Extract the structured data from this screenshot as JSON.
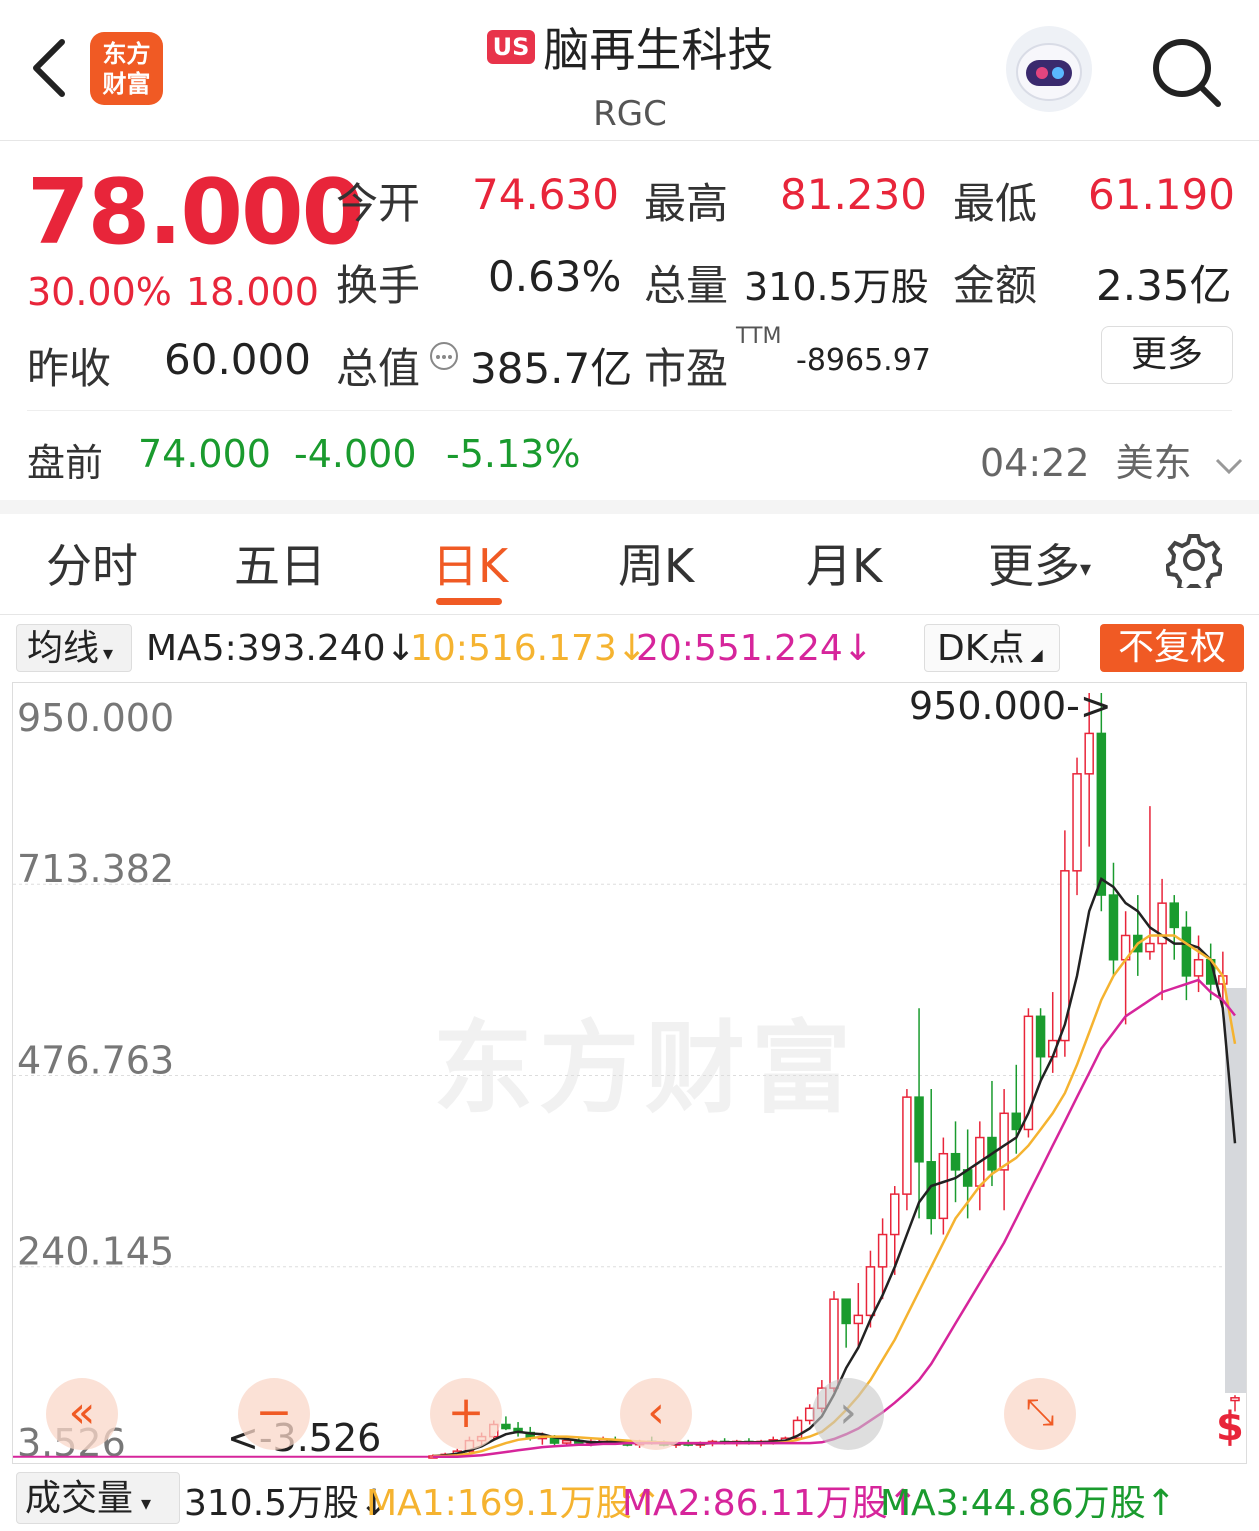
{
  "header": {
    "app_logo_line1": "东方",
    "app_logo_line2": "财富",
    "market_badge": "US",
    "stock_name": "脑再生科技",
    "ticker": "RGC"
  },
  "quote": {
    "price": "78.000",
    "change_pct": "30.00%",
    "change_abs": "18.000",
    "prev_close_label": "昨收",
    "prev_close": "60.000",
    "open_label": "今开",
    "open": "74.630",
    "high_label": "最高",
    "high": "81.230",
    "low_label": "最低",
    "low": "61.190",
    "turnover_label": "换手",
    "turnover": "0.63%",
    "volume_label": "总量",
    "volume": "310.5万股",
    "amount_label": "金额",
    "amount": "2.35亿",
    "mcap_label": "总值",
    "mcap": "385.7亿",
    "pe_label": "市盈",
    "pe_sup": "TTM",
    "pe": "-8965.97",
    "more": "更多"
  },
  "premarket": {
    "label": "盘前",
    "price": "74.000",
    "change": "-4.000",
    "pct": "-5.13%",
    "time": "04:22",
    "zone": "美东"
  },
  "tabs": [
    "分时",
    "五日",
    "日K",
    "周K",
    "月K",
    "更多"
  ],
  "active_tab": "日K",
  "ma_bar": {
    "selector": "均线",
    "ma5": "MA5:393.240↓",
    "ma10": "10:516.173↓",
    "ma20": "20:551.224↓",
    "dk": "DK点",
    "adjust": "不复权"
  },
  "volume_bar": {
    "selector": "成交量",
    "vol": "310.5万股↓",
    "ma1": "MA1:169.1万股↑",
    "ma2": "MA2:86.11万股↑",
    "ma3": "MA3:44.86万股↑"
  },
  "colors": {
    "up": "#e8253a",
    "down": "#1a9b2e",
    "accent": "#f05a24",
    "ma5": "#222222",
    "ma10": "#f5b330",
    "ma20": "#d6259b"
  },
  "chart_data": {
    "type": "candlestick",
    "y_ticks": [
      "950.000",
      "713.382",
      "476.763",
      "240.145",
      "3.526"
    ],
    "ylim": [
      3.526,
      950.0
    ],
    "max_marker": "950.000->",
    "min_marker": "<-3.526",
    "watermark": "东方财富",
    "candles": [
      {
        "o": 5,
        "h": 8,
        "l": 4,
        "c": 6
      },
      {
        "o": 6,
        "h": 10,
        "l": 5,
        "c": 8
      },
      {
        "o": 8,
        "h": 15,
        "l": 7,
        "c": 12
      },
      {
        "o": 12,
        "h": 30,
        "l": 10,
        "c": 25
      },
      {
        "o": 25,
        "h": 35,
        "l": 18,
        "c": 30
      },
      {
        "o": 30,
        "h": 50,
        "l": 25,
        "c": 45
      },
      {
        "o": 45,
        "h": 55,
        "l": 38,
        "c": 40
      },
      {
        "o": 40,
        "h": 48,
        "l": 30,
        "c": 35
      },
      {
        "o": 35,
        "h": 42,
        "l": 25,
        "c": 28
      },
      {
        "o": 28,
        "h": 35,
        "l": 20,
        "c": 30
      },
      {
        "o": 30,
        "h": 32,
        "l": 18,
        "c": 22
      },
      {
        "o": 22,
        "h": 28,
        "l": 18,
        "c": 25
      },
      {
        "o": 25,
        "h": 30,
        "l": 20,
        "c": 22
      },
      {
        "o": 22,
        "h": 28,
        "l": 18,
        "c": 24
      },
      {
        "o": 24,
        "h": 30,
        "l": 20,
        "c": 26
      },
      {
        "o": 26,
        "h": 30,
        "l": 20,
        "c": 22
      },
      {
        "o": 22,
        "h": 26,
        "l": 18,
        "c": 20
      },
      {
        "o": 20,
        "h": 26,
        "l": 16,
        "c": 24
      },
      {
        "o": 24,
        "h": 30,
        "l": 20,
        "c": 22
      },
      {
        "o": 22,
        "h": 25,
        "l": 18,
        "c": 20
      },
      {
        "o": 20,
        "h": 24,
        "l": 16,
        "c": 22
      },
      {
        "o": 22,
        "h": 26,
        "l": 18,
        "c": 20
      },
      {
        "o": 20,
        "h": 24,
        "l": 16,
        "c": 22
      },
      {
        "o": 22,
        "h": 26,
        "l": 18,
        "c": 24
      },
      {
        "o": 24,
        "h": 28,
        "l": 20,
        "c": 22
      },
      {
        "o": 22,
        "h": 26,
        "l": 18,
        "c": 24
      },
      {
        "o": 24,
        "h": 28,
        "l": 20,
        "c": 22
      },
      {
        "o": 22,
        "h": 26,
        "l": 18,
        "c": 24
      },
      {
        "o": 24,
        "h": 30,
        "l": 20,
        "c": 26
      },
      {
        "o": 26,
        "h": 30,
        "l": 22,
        "c": 28
      },
      {
        "o": 28,
        "h": 55,
        "l": 26,
        "c": 50
      },
      {
        "o": 50,
        "h": 70,
        "l": 45,
        "c": 65
      },
      {
        "o": 65,
        "h": 100,
        "l": 60,
        "c": 90
      },
      {
        "o": 90,
        "h": 210,
        "l": 85,
        "c": 200
      },
      {
        "o": 200,
        "h": 175,
        "l": 140,
        "c": 170
      },
      {
        "o": 170,
        "h": 220,
        "l": 140,
        "c": 180
      },
      {
        "o": 180,
        "h": 260,
        "l": 165,
        "c": 240
      },
      {
        "o": 240,
        "h": 300,
        "l": 200,
        "c": 280
      },
      {
        "o": 280,
        "h": 340,
        "l": 230,
        "c": 330
      },
      {
        "o": 330,
        "h": 460,
        "l": 310,
        "c": 450
      },
      {
        "o": 450,
        "h": 560,
        "l": 300,
        "c": 370
      },
      {
        "o": 370,
        "h": 460,
        "l": 280,
        "c": 300
      },
      {
        "o": 300,
        "h": 400,
        "l": 280,
        "c": 380
      },
      {
        "o": 380,
        "h": 420,
        "l": 320,
        "c": 360
      },
      {
        "o": 360,
        "h": 410,
        "l": 300,
        "c": 340
      },
      {
        "o": 340,
        "h": 420,
        "l": 310,
        "c": 400
      },
      {
        "o": 400,
        "h": 470,
        "l": 340,
        "c": 360
      },
      {
        "o": 360,
        "h": 460,
        "l": 310,
        "c": 430
      },
      {
        "o": 430,
        "h": 490,
        "l": 380,
        "c": 410
      },
      {
        "o": 410,
        "h": 560,
        "l": 400,
        "c": 550
      },
      {
        "o": 550,
        "h": 560,
        "l": 470,
        "c": 500
      },
      {
        "o": 500,
        "h": 580,
        "l": 480,
        "c": 520
      },
      {
        "o": 520,
        "h": 780,
        "l": 500,
        "c": 730
      },
      {
        "o": 730,
        "h": 870,
        "l": 700,
        "c": 850
      },
      {
        "o": 850,
        "h": 950,
        "l": 760,
        "c": 900
      },
      {
        "o": 900,
        "h": 950,
        "l": 680,
        "c": 700
      },
      {
        "o": 700,
        "h": 740,
        "l": 600,
        "c": 620
      },
      {
        "o": 620,
        "h": 680,
        "l": 540,
        "c": 650
      },
      {
        "o": 650,
        "h": 700,
        "l": 600,
        "c": 630
      },
      {
        "o": 630,
        "h": 810,
        "l": 620,
        "c": 640
      },
      {
        "o": 640,
        "h": 720,
        "l": 570,
        "c": 690
      },
      {
        "o": 690,
        "h": 700,
        "l": 620,
        "c": 660
      },
      {
        "o": 660,
        "h": 680,
        "l": 570,
        "c": 600
      },
      {
        "o": 600,
        "h": 650,
        "l": 580,
        "c": 620
      },
      {
        "o": 620,
        "h": 640,
        "l": 570,
        "c": 590
      },
      {
        "o": 590,
        "h": 630,
        "l": 560,
        "c": 600
      },
      {
        "o": 74.63,
        "h": 81.23,
        "l": 61.19,
        "c": 78
      }
    ],
    "series": [
      {
        "name": "MA5",
        "values": [
          6,
          7,
          9,
          13,
          18,
          26,
          33,
          36,
          34,
          33,
          29,
          27,
          25,
          23,
          23,
          24,
          23,
          23,
          23,
          22,
          21,
          22,
          21,
          22,
          23,
          23,
          23,
          23,
          24,
          25,
          31,
          40,
          55,
          82,
          115,
          140,
          175,
          205,
          240,
          280,
          320,
          340,
          345,
          350,
          360,
          370,
          380,
          390,
          400,
          430,
          470,
          500,
          540,
          600,
          680,
          720,
          710,
          690,
          680,
          660,
          650,
          640,
          640,
          635,
          620,
          560,
          393
        ]
      },
      {
        "name": "MA10",
        "values": [
          6,
          6,
          7,
          9,
          12,
          17,
          22,
          26,
          28,
          30,
          30,
          30,
          29,
          28,
          27,
          26,
          25,
          24,
          23,
          23,
          22,
          22,
          22,
          22,
          22,
          22,
          22,
          22,
          22,
          23,
          26,
          30,
          36,
          48,
          63,
          80,
          100,
          125,
          150,
          180,
          210,
          240,
          270,
          300,
          320,
          340,
          355,
          365,
          375,
          390,
          410,
          430,
          455,
          490,
          530,
          570,
          600,
          620,
          640,
          650,
          650,
          650,
          640,
          630,
          620,
          600,
          516
        ]
      },
      {
        "name": "MA20",
        "values": [
          5,
          5,
          5,
          6,
          7,
          9,
          11,
          13,
          15,
          17,
          18,
          19,
          20,
          20,
          21,
          21,
          22,
          22,
          22,
          22,
          22,
          22,
          22,
          22,
          22,
          22,
          22,
          22,
          22,
          22,
          22,
          22,
          23,
          27,
          33,
          40,
          50,
          60,
          72,
          85,
          100,
          120,
          145,
          170,
          195,
          220,
          245,
          270,
          300,
          330,
          360,
          390,
          420,
          450,
          480,
          510,
          530,
          550,
          560,
          570,
          580,
          585,
          590,
          595,
          580,
          570,
          551
        ]
      }
    ]
  }
}
